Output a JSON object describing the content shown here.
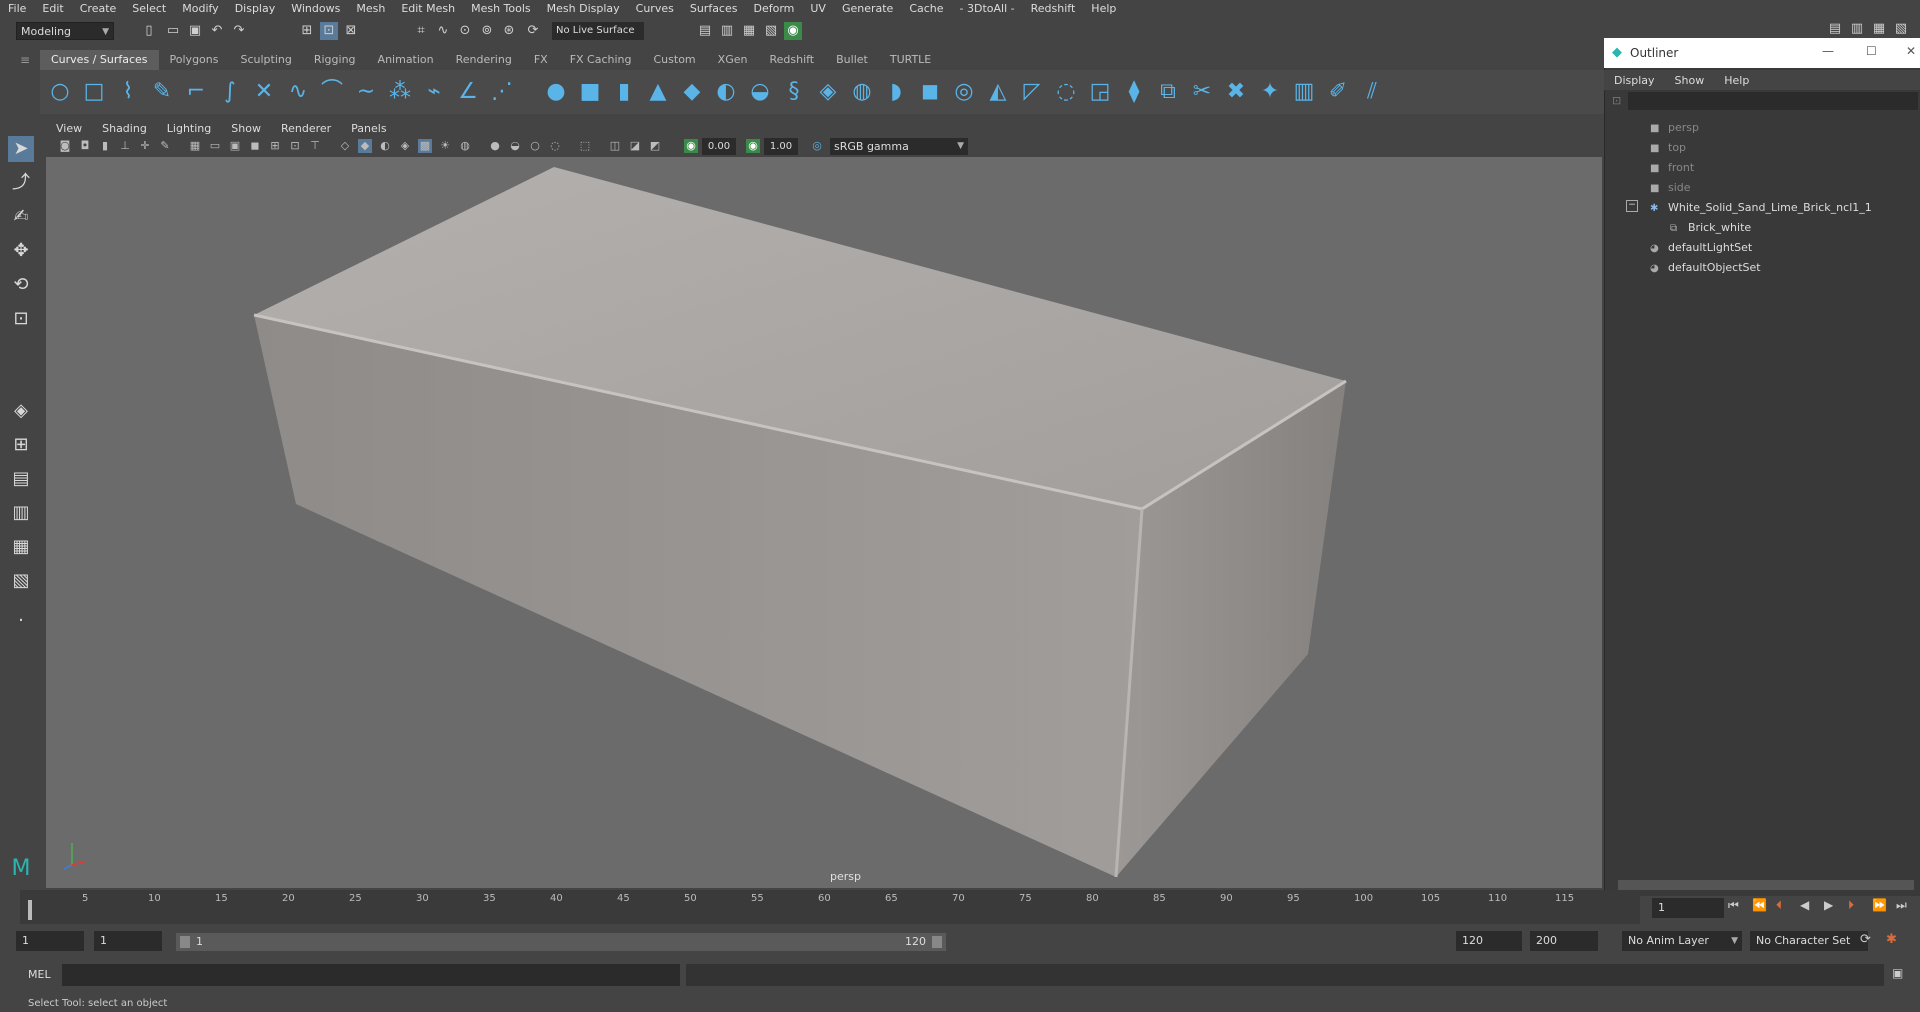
{
  "menubar": {
    "items": [
      "File",
      "Edit",
      "Create",
      "Select",
      "Modify",
      "Display",
      "Windows",
      "Mesh",
      "Edit Mesh",
      "Mesh Tools",
      "Mesh Display",
      "Curves",
      "Surfaces",
      "Deform",
      "UV",
      "Generate",
      "Cache",
      "- 3DtoAll -",
      "Redshift",
      "Help"
    ]
  },
  "statusline": {
    "mode": "Modeling",
    "live_surface": "No Live Surface"
  },
  "shelf": {
    "tabs": [
      "Curves / Surfaces",
      "Polygons",
      "Sculpting",
      "Rigging",
      "Animation",
      "Rendering",
      "FX",
      "FX Caching",
      "Custom",
      "XGen",
      "Redshift",
      "Bullet",
      "TURTLE"
    ],
    "active_tab": "Curves / Surfaces"
  },
  "panel": {
    "menu": [
      "View",
      "Shading",
      "Lighting",
      "Show",
      "Renderer",
      "Panels"
    ],
    "exposure": "0.00",
    "gamma": "1.00",
    "color_space": "sRGB gamma",
    "camera": "persp"
  },
  "outliner": {
    "title": "Outliner",
    "menu": [
      "Display",
      "Show",
      "Help"
    ],
    "items": [
      {
        "label": "persp",
        "icon": "camera-icon",
        "dim": true
      },
      {
        "label": "top",
        "icon": "camera-icon",
        "dim": true
      },
      {
        "label": "front",
        "icon": "camera-icon",
        "dim": true
      },
      {
        "label": "side",
        "icon": "camera-icon",
        "dim": true
      },
      {
        "label": "White_Solid_Sand_Lime_Brick_ncl1_1",
        "icon": "group-icon",
        "dim": false
      },
      {
        "label": "Brick_white",
        "icon": "mesh-icon",
        "dim": false
      },
      {
        "label": "defaultLightSet",
        "icon": "set-icon",
        "dim": false
      },
      {
        "label": "defaultObjectSet",
        "icon": "set-icon",
        "dim": false
      }
    ]
  },
  "timeline": {
    "ticks": [
      "5",
      "10",
      "15",
      "20",
      "25",
      "30",
      "35",
      "40",
      "45",
      "50",
      "55",
      "60",
      "65",
      "70",
      "75",
      "80",
      "85",
      "90",
      "95",
      "100",
      "105",
      "110",
      "115"
    ],
    "current_frame": "1"
  },
  "range": {
    "start": "1",
    "playback_start": "1",
    "slider_start": "1",
    "slider_end": "120",
    "playback_end": "120",
    "end": "200",
    "anim_layer": "No Anim Layer",
    "character_set": "No Character Set"
  },
  "commandline": {
    "label": "MEL"
  },
  "helpline": {
    "text": "Select Tool: select an object"
  },
  "colors": {
    "accent": "#5ab4e8",
    "background": "#444444",
    "viewport": "#6b6b6b"
  }
}
